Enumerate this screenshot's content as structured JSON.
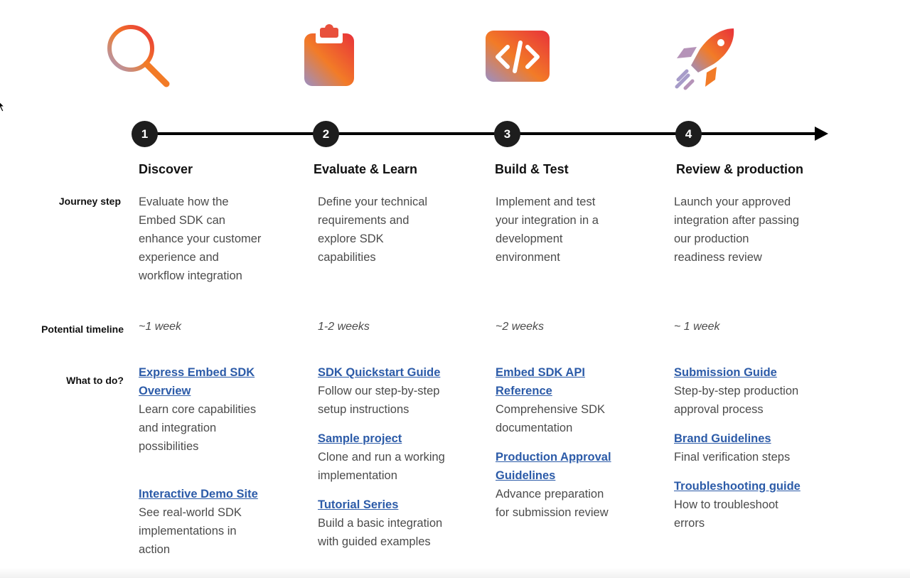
{
  "row_labels": {
    "journey_step": "Journey step",
    "potential_timeline": "Potential timeline",
    "what_to_do": "What to do?"
  },
  "colors": {
    "link": "#2c5ba8",
    "timeline": "#000000",
    "step_circle": "#1d1d1d",
    "icon_gradient": [
      "#9b8fc4",
      "#e8453c",
      "#f27b27"
    ]
  },
  "steps": [
    {
      "number": "1",
      "icon": "magnifier-icon",
      "title": "Discover",
      "journey": "Evaluate how the Embed SDK can enhance your customer experience and workflow integration",
      "timeline": "~1 week",
      "todos": [
        {
          "link": "Express Embed SDK Overview",
          "desc": "Learn core capabilities and integration possibilities"
        },
        {
          "link": "Interactive Demo Site",
          "desc": "See real-world SDK implementations in action"
        }
      ]
    },
    {
      "number": "2",
      "icon": "clipboard-icon",
      "title": "Evaluate & Learn",
      "journey": "Define your technical requirements and explore SDK capabilities",
      "timeline": "1-2 weeks",
      "todos": [
        {
          "link": "SDK Quickstart Guide",
          "desc": "Follow our step-by-step setup instructions"
        },
        {
          "link": "Sample project",
          "desc": "Clone and run a working implementation"
        },
        {
          "link": "Tutorial Series",
          "desc": "Build a basic integration with guided examples"
        }
      ]
    },
    {
      "number": "3",
      "icon": "code-icon",
      "title": "Build & Test",
      "journey": "Implement and test your integration in a development environment",
      "timeline": "~2 weeks",
      "todos": [
        {
          "link": "Embed SDK API Reference",
          "desc": "Comprehensive SDK documentation"
        },
        {
          "link": "Production Approval Guidelines",
          "desc": "Advance preparation for submission review"
        }
      ]
    },
    {
      "number": "4",
      "icon": "rocket-icon",
      "title": "Review & production",
      "journey": "Launch your approved integration after passing our production readiness review",
      "timeline": "~ 1 week",
      "todos": [
        {
          "link": "Submission Guide",
          "desc": "Step-by-step production approval process"
        },
        {
          "link": "Brand Guidelines",
          "desc": "Final verification steps"
        },
        {
          "link": "Troubleshooting guide",
          "desc": "How to troubleshoot errors"
        }
      ]
    }
  ]
}
